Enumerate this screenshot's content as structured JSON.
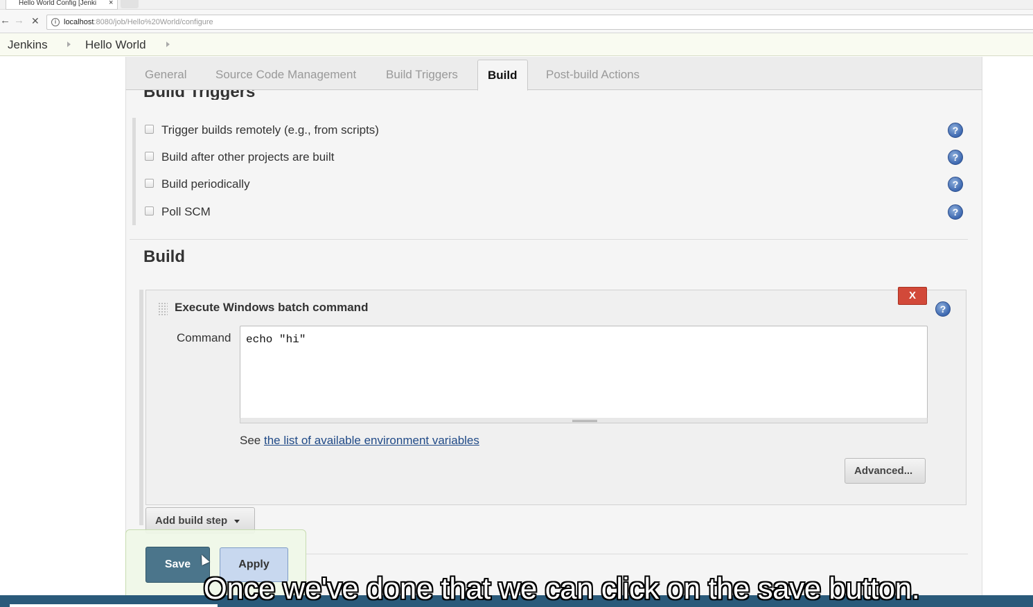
{
  "browser": {
    "tab_title": "Hello World Config [Jenki",
    "tab_close": "×",
    "url_host": "localhost",
    "url_rest": ":8080/job/Hello%20World/configure",
    "back_glyph": "←",
    "forward_glyph": "→",
    "stop_glyph": "✕",
    "info_glyph": "i"
  },
  "breadcrumbs": {
    "items": [
      "Jenkins",
      "Hello World"
    ]
  },
  "config_tabs": {
    "items": [
      "General",
      "Source Code Management",
      "Build Triggers",
      "Build",
      "Post-build Actions"
    ],
    "active": "Build"
  },
  "build_triggers": {
    "heading": "Build Triggers",
    "options": [
      {
        "label": "Trigger builds remotely (e.g., from scripts)",
        "checked": false
      },
      {
        "label": "Build after other projects are built",
        "checked": false
      },
      {
        "label": "Build periodically",
        "checked": false
      },
      {
        "label": "Poll SCM",
        "checked": false
      }
    ]
  },
  "build": {
    "heading": "Build",
    "step": {
      "title": "Execute Windows batch command",
      "delete_label": "X",
      "command_label": "Command",
      "command_value": "echo \"hi\"",
      "env_prefix": "See ",
      "env_link": "the list of available environment variables",
      "advanced_label": "Advanced..."
    },
    "add_step_label": "Add build step"
  },
  "actions": {
    "save_label": "Save",
    "apply_label": "Apply"
  },
  "help_glyph": "?",
  "caption": "Once we've done that we can click on the save button.",
  "colors": {
    "save_button": "#4b758b",
    "apply_button": "#c8d8ef",
    "delete_button": "#d24939",
    "link": "#204a87",
    "help_icon": "#3d68b0"
  }
}
